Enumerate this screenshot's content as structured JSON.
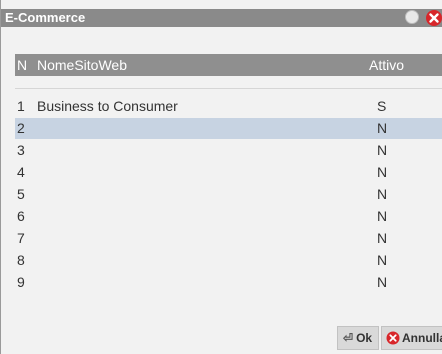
{
  "window": {
    "title": "E-Commerce",
    "close_icon": "close-icon",
    "circle_icon": "minimize-circle-icon"
  },
  "grid": {
    "columns": [
      "N",
      "NomeSitoWeb",
      "Attivo"
    ],
    "rows": [
      {
        "n": "1",
        "name": "Business to Consumer",
        "attivo": "S"
      },
      {
        "n": "2",
        "name": "",
        "attivo": "N"
      },
      {
        "n": "3",
        "name": "",
        "attivo": "N"
      },
      {
        "n": "4",
        "name": "",
        "attivo": "N"
      },
      {
        "n": "5",
        "name": "",
        "attivo": "N"
      },
      {
        "n": "6",
        "name": "",
        "attivo": "N"
      },
      {
        "n": "7",
        "name": "",
        "attivo": "N"
      },
      {
        "n": "8",
        "name": "",
        "attivo": "N"
      },
      {
        "n": "9",
        "name": "",
        "attivo": "N"
      }
    ],
    "selected_row": 2
  },
  "footer": {
    "ok_label": "Ok",
    "cancel_label": "Annulla"
  },
  "colors": {
    "header_bg": "#8f8f8f",
    "selected_bg": "#c7d3e2",
    "close_red": "#d8262a"
  }
}
